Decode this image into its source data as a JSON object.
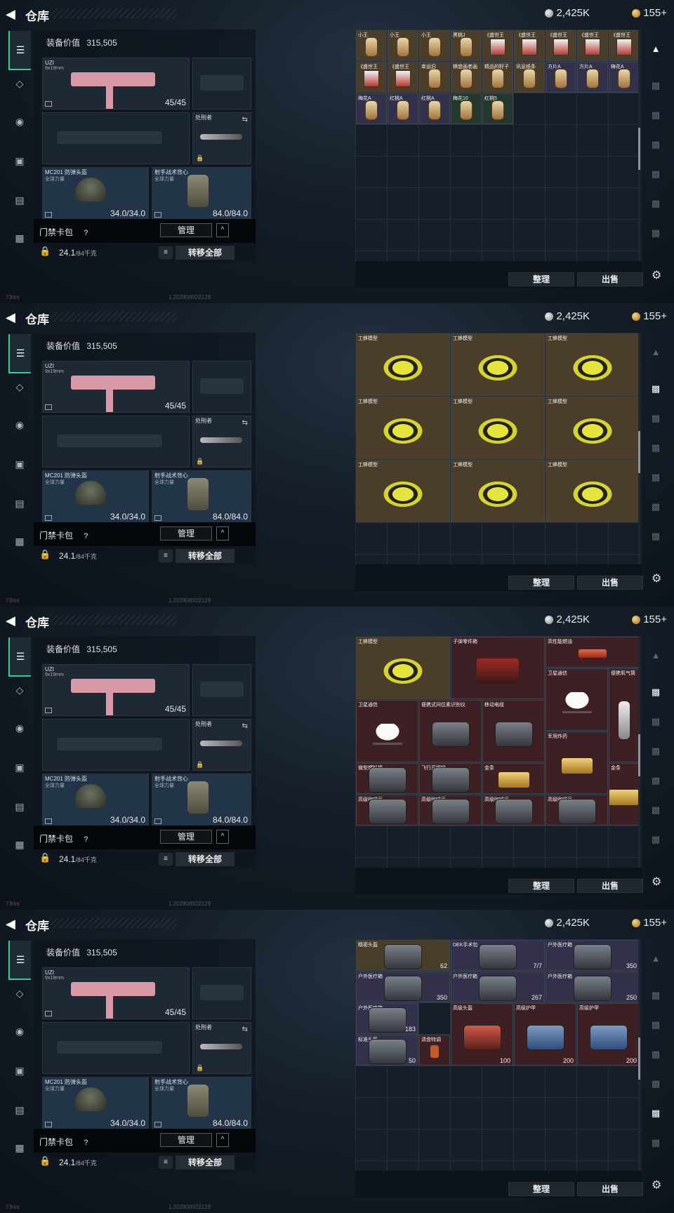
{
  "header": {
    "title": "仓库",
    "silver": "2,425K",
    "gold": "155+"
  },
  "loadout": {
    "equip_value_label": "装备价值",
    "equip_value": "315,505",
    "primary": {
      "name": "UZI",
      "sub": "9x19mm",
      "count": "45/45"
    },
    "melee": {
      "name": "处刑者"
    },
    "helmet": {
      "name": "MC201 防弹头盔",
      "sub": "全球力量",
      "count": "34.0/34.0"
    },
    "vest": {
      "name": "射手战术背心",
      "sub": "全球力量",
      "count": "84.0/84.0"
    },
    "card_label": "门禁卡包",
    "help": "?",
    "manage": "管理",
    "collapse": "^",
    "weight": "24.1",
    "weight_unit": "/84千克",
    "transfer": "转移全部",
    "list": "≡"
  },
  "footer": {
    "ping": "73ms",
    "build": "1.202808022129"
  },
  "buttons": {
    "sort": "整理",
    "sell": "出售"
  },
  "screens": [
    {
      "items": [
        {
          "name": "小王",
          "type": "card",
          "bg": "brown"
        },
        {
          "name": "小王",
          "type": "card",
          "bg": "brown"
        },
        {
          "name": "小王",
          "type": "card",
          "bg": "brown"
        },
        {
          "name": "黑桃J",
          "type": "card",
          "bg": "brown"
        },
        {
          "name": "《盛世王",
          "type": "red",
          "bg": "brown"
        },
        {
          "name": "《盛世王",
          "type": "red",
          "bg": "brown"
        },
        {
          "name": "《盛世王",
          "type": "red",
          "bg": "brown"
        },
        {
          "name": "《盛世王",
          "type": "red",
          "bg": "brown"
        },
        {
          "name": "《盛世王",
          "type": "red",
          "bg": "brown"
        },
        {
          "name": "《盛世王",
          "type": "red",
          "bg": "brown"
        },
        {
          "name": "《盛世王",
          "type": "red",
          "bg": "brown"
        },
        {
          "name": "幸运旧",
          "type": "card",
          "bg": "brown"
        },
        {
          "name": "棋盘画老画",
          "type": "card",
          "bg": "brown"
        },
        {
          "name": "精品的籽子",
          "type": "card",
          "bg": "brown"
        },
        {
          "name": "讯息纸条",
          "type": "card",
          "bg": "brown"
        },
        {
          "name": "方片A",
          "type": "card",
          "bg": "purple"
        },
        {
          "name": "方片A",
          "type": "card",
          "bg": "purple"
        },
        {
          "name": "梅花A",
          "type": "card",
          "bg": "purple"
        },
        {
          "name": "梅花A",
          "type": "card",
          "bg": "purple"
        },
        {
          "name": "红桃A",
          "type": "card",
          "bg": "purple"
        },
        {
          "name": "红桃A",
          "type": "card",
          "bg": "purple"
        },
        {
          "name": "梅花10",
          "type": "card",
          "bg": "green"
        },
        {
          "name": "红桃5",
          "type": "card",
          "bg": "green"
        }
      ]
    },
    {
      "items": [
        {
          "name": "工蜂模型",
          "type": "bee",
          "bg": "brown"
        },
        {
          "name": "工蜂模型",
          "type": "bee",
          "bg": "brown"
        },
        {
          "name": "工蜂模型",
          "type": "bee",
          "bg": "brown"
        },
        {
          "name": "工蜂模型",
          "type": "bee",
          "bg": "brown"
        },
        {
          "name": "工蜂模型",
          "type": "bee",
          "bg": "brown"
        },
        {
          "name": "工蜂模型",
          "type": "bee",
          "bg": "brown"
        },
        {
          "name": "工蜂模型",
          "type": "bee",
          "bg": "brown"
        },
        {
          "name": "工蜂模型",
          "type": "bee",
          "bg": "brown"
        },
        {
          "name": "工蜂模型",
          "type": "bee",
          "bg": "brown"
        }
      ]
    },
    {
      "items": [
        {
          "name": "工蜂模型",
          "type": "bee",
          "bg": "brown"
        },
        {
          "name": "子弹零件箱",
          "type": "engine",
          "bg": "red"
        },
        {
          "name": "高性能燃油",
          "type": "bar",
          "bg": "red"
        },
        {
          "name": "卫星通信",
          "type": "dish",
          "bg": "red"
        },
        {
          "name": "便携氧气筒",
          "type": "bottle",
          "bg": "red"
        },
        {
          "name": "卫星通信",
          "type": "dish",
          "bg": "red"
        },
        {
          "name": "便携式间位素识别仪",
          "type": "box",
          "bg": "red"
        },
        {
          "name": "移动电缆",
          "type": "box",
          "bg": "red"
        },
        {
          "name": "军用炸药",
          "type": "gold",
          "bg": "red"
        },
        {
          "name": "微型燃料棒",
          "type": "box",
          "bg": "red"
        },
        {
          "name": "飞行员眼镜",
          "type": "box",
          "bg": "red"
        },
        {
          "name": "金条",
          "type": "gold",
          "bg": "red"
        },
        {
          "name": "金条",
          "type": "gold",
          "bg": "red"
        },
        {
          "name": "高级咖啡豆",
          "type": "box",
          "bg": "red"
        },
        {
          "name": "高级咖啡豆",
          "type": "box",
          "bg": "red"
        },
        {
          "name": "高级咖啡豆",
          "type": "box",
          "bg": "red"
        },
        {
          "name": "高级咖啡豆",
          "type": "box",
          "bg": "red"
        }
      ]
    },
    {
      "items": [
        {
          "name": "精密头盔",
          "type": "box",
          "bg": "brown",
          "count": "62"
        },
        {
          "name": "DEK手术包",
          "type": "box",
          "bg": "purple",
          "count": "7/7"
        },
        {
          "name": "户外医疗箱",
          "type": "box",
          "bg": "purple",
          "count": "350"
        },
        {
          "name": "户外医疗箱",
          "type": "box",
          "bg": "purple",
          "count": "350"
        },
        {
          "name": "户外医疗箱",
          "type": "box",
          "bg": "purple",
          "count": "267"
        },
        {
          "name": "户外医疗箱",
          "type": "box",
          "bg": "purple",
          "count": "250"
        },
        {
          "name": "户外医疗箱",
          "type": "box",
          "bg": "purple",
          "count": "183"
        },
        {
          "name": "高级头盔",
          "type": "redbox",
          "bg": "red",
          "count": "100"
        },
        {
          "name": "高级护甲",
          "type": "bluebox",
          "bg": "red",
          "count": "200"
        },
        {
          "name": "高级护甲",
          "type": "bluebox",
          "bg": "red",
          "count": "200"
        },
        {
          "name": "标准头盔",
          "type": "box",
          "bg": "purple",
          "count": "50"
        },
        {
          "name": "清盘特调",
          "type": "orange",
          "bg": "red",
          "count": ""
        }
      ]
    }
  ]
}
